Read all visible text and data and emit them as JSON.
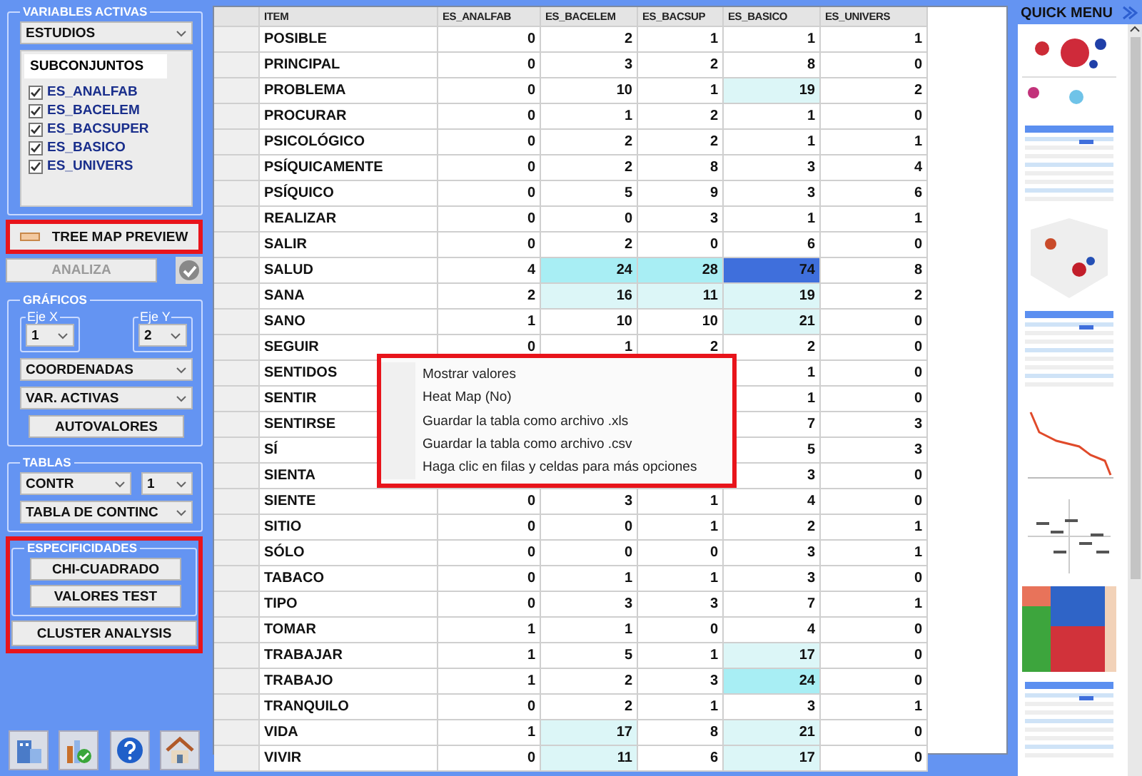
{
  "left_panel": {
    "variables_activas": {
      "title": "VARIABLES ACTIVAS",
      "dropdown": "ESTUDIOS",
      "list_header": "SUBCONJUNTOS",
      "items": [
        {
          "label": "ES_ANALFAB",
          "checked": true
        },
        {
          "label": "ES_BACELEM",
          "checked": true
        },
        {
          "label": "ES_BACSUPER",
          "checked": true
        },
        {
          "label": "ES_BASICO",
          "checked": true
        },
        {
          "label": "ES_UNIVERS",
          "checked": true
        }
      ]
    },
    "tree_map_button": "TREE MAP PREVIEW",
    "analiza_button": {
      "label": "ANALIZA",
      "disabled": true
    },
    "graficos": {
      "title": "GRÁFICOS",
      "eje_x": {
        "label": "Eje X",
        "value": "1"
      },
      "eje_y": {
        "label": "Eje Y",
        "value": "2"
      },
      "dropdowns": [
        "COORDENADAS",
        "VAR. ACTIVAS"
      ],
      "button": "AUTOVALORES"
    },
    "tablas": {
      "title": "TABLAS",
      "dropdown_1": "CONTR",
      "dropdown_2": "1",
      "dropdown_3": "TABLA DE CONTINC"
    },
    "especificidades": {
      "title": "ESPECIFICIDADES",
      "buttons": [
        "CHI-CUADRADO",
        "VALORES TEST"
      ]
    },
    "cluster_button": "CLUSTER ANALYSIS"
  },
  "table": {
    "columns": [
      "ITEM",
      "ES_ANALFAB",
      "ES_BACELEM",
      "ES_BACSUP",
      "ES_BASICO",
      "ES_UNIVERS"
    ],
    "rows": [
      {
        "item": "POSIBLE",
        "cells": [
          {
            "value": "0"
          },
          {
            "value": "2"
          },
          {
            "value": "1"
          },
          {
            "value": "1"
          },
          {
            "value": "1"
          }
        ]
      },
      {
        "item": "PRINCIPAL",
        "cells": [
          {
            "value": "0"
          },
          {
            "value": "3"
          },
          {
            "value": "2"
          },
          {
            "value": "8"
          },
          {
            "value": "0"
          }
        ]
      },
      {
        "item": "PROBLEMA",
        "cells": [
          {
            "value": "0"
          },
          {
            "value": "10"
          },
          {
            "value": "1"
          },
          {
            "value": "19",
            "color": "#dcf6f7"
          },
          {
            "value": "2"
          }
        ]
      },
      {
        "item": "PROCURAR",
        "cells": [
          {
            "value": "0"
          },
          {
            "value": "1"
          },
          {
            "value": "2"
          },
          {
            "value": "1"
          },
          {
            "value": "0"
          }
        ]
      },
      {
        "item": "PSICOLÓGICO",
        "cells": [
          {
            "value": "0"
          },
          {
            "value": "2"
          },
          {
            "value": "2"
          },
          {
            "value": "1"
          },
          {
            "value": "1"
          }
        ]
      },
      {
        "item": "PSÍQUICAMENTE",
        "cells": [
          {
            "value": "0"
          },
          {
            "value": "2"
          },
          {
            "value": "8"
          },
          {
            "value": "3"
          },
          {
            "value": "4"
          }
        ]
      },
      {
        "item": "PSÍQUICO",
        "cells": [
          {
            "value": "0"
          },
          {
            "value": "5"
          },
          {
            "value": "9"
          },
          {
            "value": "3"
          },
          {
            "value": "6"
          }
        ]
      },
      {
        "item": "REALIZAR",
        "cells": [
          {
            "value": "0"
          },
          {
            "value": "0"
          },
          {
            "value": "3"
          },
          {
            "value": "1"
          },
          {
            "value": "1"
          }
        ]
      },
      {
        "item": "SALIR",
        "cells": [
          {
            "value": "0"
          },
          {
            "value": "2"
          },
          {
            "value": "0"
          },
          {
            "value": "6"
          },
          {
            "value": "0"
          }
        ]
      },
      {
        "item": "SALUD",
        "cells": [
          {
            "value": "4"
          },
          {
            "value": "24",
            "color": "#a8eef4"
          },
          {
            "value": "28",
            "color": "#a8eef4"
          },
          {
            "value": "74",
            "color": "#3f6fdc"
          },
          {
            "value": "8"
          }
        ]
      },
      {
        "item": "SANA",
        "cells": [
          {
            "value": "2"
          },
          {
            "value": "16",
            "color": "#dcf6f7"
          },
          {
            "value": "11",
            "color": "#dcf6f7"
          },
          {
            "value": "19",
            "color": "#dcf6f7"
          },
          {
            "value": "2"
          }
        ]
      },
      {
        "item": "SANO",
        "cells": [
          {
            "value": "1"
          },
          {
            "value": "10"
          },
          {
            "value": "10"
          },
          {
            "value": "21",
            "color": "#dcf6f7"
          },
          {
            "value": "0"
          }
        ]
      },
      {
        "item": "SEGUIR",
        "cells": [
          {
            "value": "0"
          },
          {
            "value": "1"
          },
          {
            "value": "2"
          },
          {
            "value": "2"
          },
          {
            "value": "0"
          }
        ]
      },
      {
        "item": "SENTIDOS",
        "cells": [
          null,
          null,
          null,
          {
            "value": "1"
          },
          {
            "value": "0"
          }
        ]
      },
      {
        "item": "SENTIR",
        "cells": [
          null,
          null,
          null,
          {
            "value": "1"
          },
          {
            "value": "0"
          }
        ]
      },
      {
        "item": "SENTIRSE",
        "cells": [
          null,
          null,
          null,
          {
            "value": "7"
          },
          {
            "value": "3"
          }
        ]
      },
      {
        "item": "SÍ",
        "cells": [
          null,
          null,
          null,
          {
            "value": "5"
          },
          {
            "value": "3"
          }
        ]
      },
      {
        "item": "SIENTA",
        "cells": [
          null,
          null,
          null,
          {
            "value": "3"
          },
          {
            "value": "0"
          }
        ]
      },
      {
        "item": "SIENTE",
        "cells": [
          {
            "value": "0"
          },
          {
            "value": "3"
          },
          {
            "value": "1"
          },
          {
            "value": "4"
          },
          {
            "value": "0"
          }
        ]
      },
      {
        "item": "SITIO",
        "cells": [
          {
            "value": "0"
          },
          {
            "value": "0"
          },
          {
            "value": "1"
          },
          {
            "value": "2"
          },
          {
            "value": "1"
          }
        ]
      },
      {
        "item": "SÓLO",
        "cells": [
          {
            "value": "0"
          },
          {
            "value": "0"
          },
          {
            "value": "0"
          },
          {
            "value": "3"
          },
          {
            "value": "1"
          }
        ]
      },
      {
        "item": "TABACO",
        "cells": [
          {
            "value": "0"
          },
          {
            "value": "1"
          },
          {
            "value": "1"
          },
          {
            "value": "3"
          },
          {
            "value": "0"
          }
        ]
      },
      {
        "item": "TIPO",
        "cells": [
          {
            "value": "0"
          },
          {
            "value": "3"
          },
          {
            "value": "3"
          },
          {
            "value": "7"
          },
          {
            "value": "1"
          }
        ]
      },
      {
        "item": "TOMAR",
        "cells": [
          {
            "value": "1"
          },
          {
            "value": "1"
          },
          {
            "value": "0"
          },
          {
            "value": "4"
          },
          {
            "value": "0"
          }
        ]
      },
      {
        "item": "TRABAJAR",
        "cells": [
          {
            "value": "1"
          },
          {
            "value": "5"
          },
          {
            "value": "1"
          },
          {
            "value": "17",
            "color": "#dcf6f7"
          },
          {
            "value": "0"
          }
        ]
      },
      {
        "item": "TRABAJO",
        "cells": [
          {
            "value": "1"
          },
          {
            "value": "2"
          },
          {
            "value": "3"
          },
          {
            "value": "24",
            "color": "#a8eef4"
          },
          {
            "value": "0"
          }
        ]
      },
      {
        "item": "TRANQUILO",
        "cells": [
          {
            "value": "0"
          },
          {
            "value": "2"
          },
          {
            "value": "1"
          },
          {
            "value": "3"
          },
          {
            "value": "1"
          }
        ]
      },
      {
        "item": "VIDA",
        "cells": [
          {
            "value": "1"
          },
          {
            "value": "17",
            "color": "#dcf6f7"
          },
          {
            "value": "8"
          },
          {
            "value": "21",
            "color": "#dcf6f7"
          },
          {
            "value": "0"
          }
        ]
      },
      {
        "item": "VIVIR",
        "cells": [
          {
            "value": "0"
          },
          {
            "value": "11",
            "color": "#dcf6f7"
          },
          {
            "value": "6"
          },
          {
            "value": "17",
            "color": "#dcf6f7"
          },
          {
            "value": "0"
          }
        ]
      }
    ]
  },
  "context_menu": {
    "items": [
      "Mostrar valores",
      "Heat Map (No)",
      "Guardar la tabla como archivo .xls",
      "Guardar la tabla como archivo .csv",
      "Haga clic en filas y celdas para más opciones"
    ]
  },
  "quick_menu": {
    "title": "QUICK MENU"
  }
}
